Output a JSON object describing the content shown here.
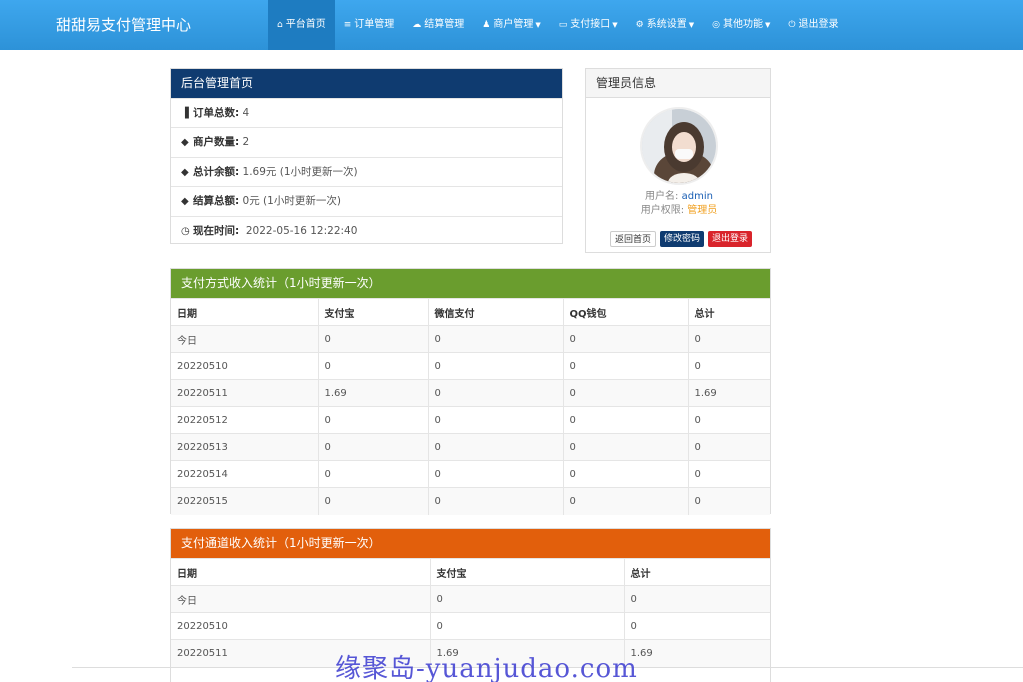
{
  "brand": "甜甜易支付管理中心",
  "nav": [
    {
      "icon": "home-icon",
      "glyph": "⌂",
      "label": "平台首页",
      "active": true,
      "caret": false
    },
    {
      "icon": "list-icon",
      "glyph": "≡",
      "label": "订单管理",
      "active": false,
      "caret": false
    },
    {
      "icon": "cloud-icon",
      "glyph": "☁",
      "label": "结算管理",
      "active": false,
      "caret": false
    },
    {
      "icon": "user-icon",
      "glyph": "♟",
      "label": "商户管理",
      "active": false,
      "caret": true
    },
    {
      "icon": "card-icon",
      "glyph": "▭",
      "label": "支付接口",
      "active": false,
      "caret": true
    },
    {
      "icon": "gear-icon",
      "glyph": "⚙",
      "label": "系统设置",
      "active": false,
      "caret": true
    },
    {
      "icon": "globe-icon",
      "glyph": "◎",
      "label": "其他功能",
      "active": false,
      "caret": true
    },
    {
      "icon": "power-icon",
      "glyph": "⏻",
      "label": "退出登录",
      "active": false,
      "caret": false
    }
  ],
  "info": {
    "title": "后台管理首页",
    "rows": [
      {
        "icon": "bar-chart-icon",
        "glyph": "▐",
        "label": "订单总数:",
        "value": " 4"
      },
      {
        "icon": "drop-icon",
        "glyph": "◆",
        "label": "商户数量:",
        "value": " 2"
      },
      {
        "icon": "drop-icon",
        "glyph": "◆",
        "label": "总计余额:",
        "value": " 1.69元 (1小时更新一次)"
      },
      {
        "icon": "drop-icon",
        "glyph": "◆",
        "label": "结算总额:",
        "value": " 0元 (1小时更新一次)"
      },
      {
        "icon": "clock-icon",
        "glyph": "◷",
        "label": "现在时间:",
        "value": "  2022-05-16 12:22:40"
      }
    ]
  },
  "admin": {
    "title": "管理员信息",
    "username_label": "用户名: ",
    "username": "admin",
    "role_label": "用户权限: ",
    "role": "管理员",
    "btn_home": "返回首页",
    "btn_pwd": "修改密码",
    "btn_logout": "退出登录"
  },
  "t1": {
    "title": "支付方式收入统计（1小时更新一次）",
    "headers": [
      "日期",
      "支付宝",
      "微信支付",
      "QQ钱包",
      "总计"
    ],
    "rows": [
      [
        "今日",
        "0",
        "0",
        "0",
        "0"
      ],
      [
        "20220510",
        "0",
        "0",
        "0",
        "0"
      ],
      [
        "20220511",
        "1.69",
        "0",
        "0",
        "1.69"
      ],
      [
        "20220512",
        "0",
        "0",
        "0",
        "0"
      ],
      [
        "20220513",
        "0",
        "0",
        "0",
        "0"
      ],
      [
        "20220514",
        "0",
        "0",
        "0",
        "0"
      ],
      [
        "20220515",
        "0",
        "0",
        "0",
        "0"
      ]
    ]
  },
  "t2": {
    "title": "支付通道收入统计（1小时更新一次）",
    "headers": [
      "日期",
      "支付宝",
      "总计"
    ],
    "rows": [
      [
        "今日",
        "0",
        "0"
      ],
      [
        "20220510",
        "0",
        "0"
      ],
      [
        "20220511",
        "1.69",
        "1.69"
      ]
    ]
  },
  "watermark": "缘聚岛-yuanjudao.com",
  "colors": {
    "nav": "#2d92d8",
    "info_header": "#0f3b70",
    "t1_header": "#6a9d2e",
    "t2_header": "#e25f0c",
    "link": "#1a5fb4",
    "role": "#f0a020"
  }
}
